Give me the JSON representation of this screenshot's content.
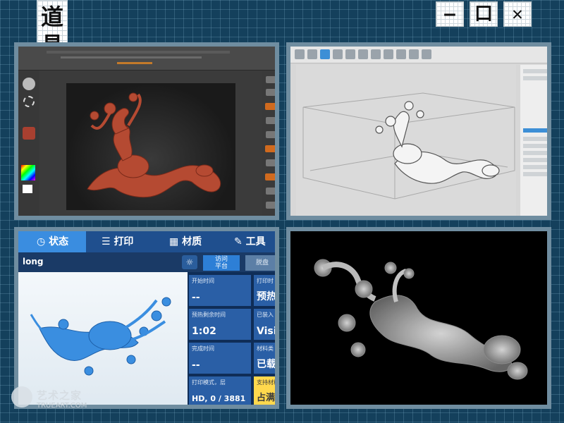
{
  "title": {
    "chars": [
      "道",
      "具"
    ]
  },
  "window_controls": {
    "minimize": "—",
    "maximize": "口",
    "close": "✕"
  },
  "printer": {
    "tabs": [
      "状态",
      "打印",
      "材质",
      "工具"
    ],
    "file_name": "long",
    "bulb_icon": "lightbulb-icon",
    "visit_button": "访问\n平台",
    "tray_button": "脱盘",
    "cells": {
      "start_time_label": "开始时间",
      "start_time_value": "--",
      "print_partial_label": "打印时",
      "print_partial_value": "预热",
      "preheat_remaining_label": "预热剩余时间",
      "preheat_remaining_value": "1:02",
      "loaded_label": "已装入",
      "loaded_value": "Visi",
      "finish_time_label": "完成时间",
      "finish_time_value": "--",
      "material_label": "材料类",
      "material_value": "已载",
      "print_mode_label": "打印模式，层",
      "print_mode_value": "HD, 0 / 3881",
      "support_label": "支持材料",
      "support_value": "占满"
    }
  },
  "watermark": {
    "cn": "艺术之家",
    "en": "TRUEART.COM"
  },
  "colors": {
    "bg": "#14405c",
    "panel_border": "#6f8da0",
    "printer_tab_bg": "#1f4f8e",
    "printer_cell": "#2a5fa6",
    "printer_yellow": "#ffd84d",
    "model_red": "#b54a32",
    "model_blue": "#3a8ee0"
  }
}
